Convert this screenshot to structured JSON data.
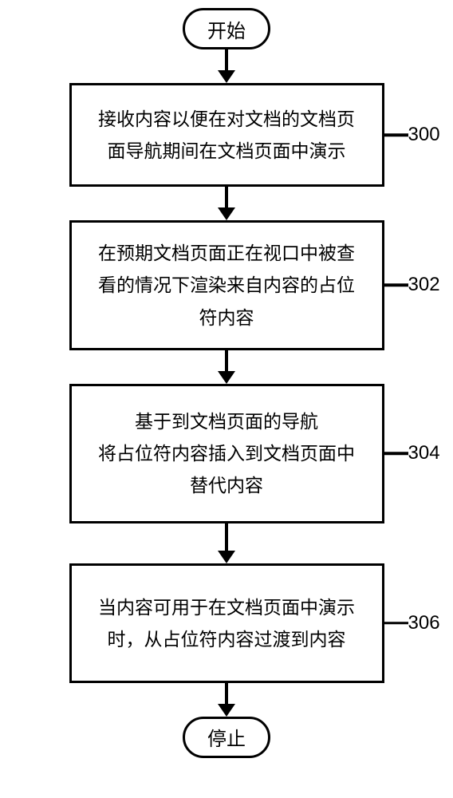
{
  "chart_data": {
    "type": "flowchart",
    "title": "",
    "nodes": [
      {
        "id": "start",
        "type": "terminator",
        "label": "开始"
      },
      {
        "id": "step1",
        "type": "process",
        "label": "接收内容以便在对文档的文档页面导航期间在文档页面中演示",
        "ref": "300"
      },
      {
        "id": "step2",
        "type": "process",
        "label": "在预期文档页面正在视口中被查看的情况下渲染来自内容的占位符内容",
        "ref": "302"
      },
      {
        "id": "step3",
        "type": "process",
        "label": "基于到文档页面的导航\n将占位符内容插入到文档页面中替代内容",
        "ref": "304"
      },
      {
        "id": "step4",
        "type": "process",
        "label": "当内容可用于在文档页面中演示时，从占位符内容过渡到内容",
        "ref": "306"
      },
      {
        "id": "stop",
        "type": "terminator",
        "label": "停止"
      }
    ],
    "edges": [
      {
        "from": "start",
        "to": "step1"
      },
      {
        "from": "step1",
        "to": "step2"
      },
      {
        "from": "step2",
        "to": "step3"
      },
      {
        "from": "step3",
        "to": "step4"
      },
      {
        "from": "step4",
        "to": "stop"
      }
    ]
  },
  "start_label": "开始",
  "stop_label": "停止",
  "steps": {
    "s1": {
      "text": "接收内容以便在对文档的文档页面导航期间在文档页面中演示",
      "ref": "300"
    },
    "s2": {
      "text": "在预期文档页面正在视口中被查看的情况下渲染来自内容的占位符内容",
      "ref": "302"
    },
    "s3_l1": "基于到文档页面的导航",
    "s3_l2": "将占位符内容插入到文档页面中替代内容",
    "s3_ref": "304",
    "s4": {
      "text": "当内容可用于在文档页面中演示时，从占位符内容过渡到内容",
      "ref": "306"
    }
  }
}
